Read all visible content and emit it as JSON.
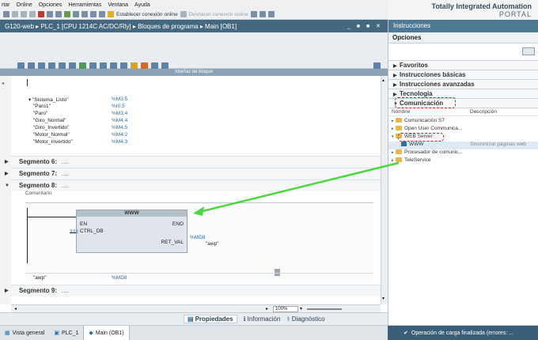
{
  "menu": [
    "rtar",
    "Online",
    "Opciones",
    "Herramientas",
    "Ventana",
    "Ayuda"
  ],
  "toolbar": {
    "connect": "Establecer conexión online",
    "disconnect": "Deshacer conexión online"
  },
  "brand": {
    "line1": "Totally Integrated Automation",
    "line2": "PORTAL"
  },
  "titlebar": {
    "path": "G120-web ▸ PLC_1 [CPU 1214C AC/DC/Rly] ▸ Bloques de programa ▸ Main [OB1]",
    "controls": "_ ■ ■ ✕"
  },
  "editor": {
    "interface_label": "Interfaz de bloque",
    "tags": [
      {
        "name": "▾ \"Sistema_Listo\"",
        "addr": "%M3.5"
      },
      {
        "name": "\"Paro1\"",
        "addr": "%I0.5"
      },
      {
        "name": "\"Paro\"",
        "addr": "%M3.4"
      },
      {
        "name": "\"Giro_Normal\"",
        "addr": "%M4.4"
      },
      {
        "name": "\"Giro_Invertido\"",
        "addr": "%M4.5"
      },
      {
        "name": "\"Motor_Normal\"",
        "addr": "%M4.2"
      },
      {
        "name": "\"Motor_Invertido\"",
        "addr": "%M4.3"
      }
    ],
    "segments": [
      {
        "label": "Segmento 6:",
        "dots": "....",
        "arrow": "▶"
      },
      {
        "label": "Segmento 7:",
        "dots": "....",
        "arrow": "▶"
      },
      {
        "label": "Segmento 8:",
        "dots": "....",
        "arrow": "▼"
      }
    ],
    "comment": "Comentario",
    "block": {
      "name": "WWW",
      "en": "EN",
      "eno": "ENO",
      "ctrl_db": "CTRL_DB",
      "ctrl_val": "333",
      "ret_val": "RET_VAL",
      "ret_addr": "%MD8",
      "ret_name": "\"awp\""
    },
    "bottom_tag": {
      "name": "\"awp\"",
      "addr": "%MD8"
    },
    "segment9": {
      "label": "Segmento 9:",
      "dots": "....",
      "arrow": "▶"
    },
    "zoom": "100%"
  },
  "props": {
    "propiedades": "Propiedades",
    "informacion": "Información",
    "diagnostico": "Diagnóstico"
  },
  "status": {
    "vista": "Vista general",
    "plc": "PLC_1",
    "main": "Main (OB1)",
    "msg": "Operación de carga finalizada (errores: ..."
  },
  "rpanel": {
    "title": "Instrucciones",
    "options": "Opciones",
    "sections": [
      "Favoritos",
      "Instrucciones básicas",
      "Instrucciones avanzadas",
      "Tecnología",
      "Comunicación"
    ],
    "col_name": "Nombre",
    "col_desc": "Descripción",
    "tree": [
      {
        "label": "Comunicación S7",
        "desc": "",
        "indent": 0
      },
      {
        "label": "Open User Communica...",
        "desc": "",
        "indent": 0
      },
      {
        "label": "WEB Server",
        "desc": "",
        "indent": 0
      },
      {
        "label": "WWW",
        "desc": "Sincronizar páginas web",
        "indent": 1
      },
      {
        "label": "Procesador de comunic...",
        "desc": "",
        "indent": 0
      },
      {
        "label": "TeleService",
        "desc": "",
        "indent": 0
      }
    ]
  },
  "colors": {
    "titlebar": "#44687f",
    "annotation": "#e02020",
    "arrow": "#4cd640"
  }
}
